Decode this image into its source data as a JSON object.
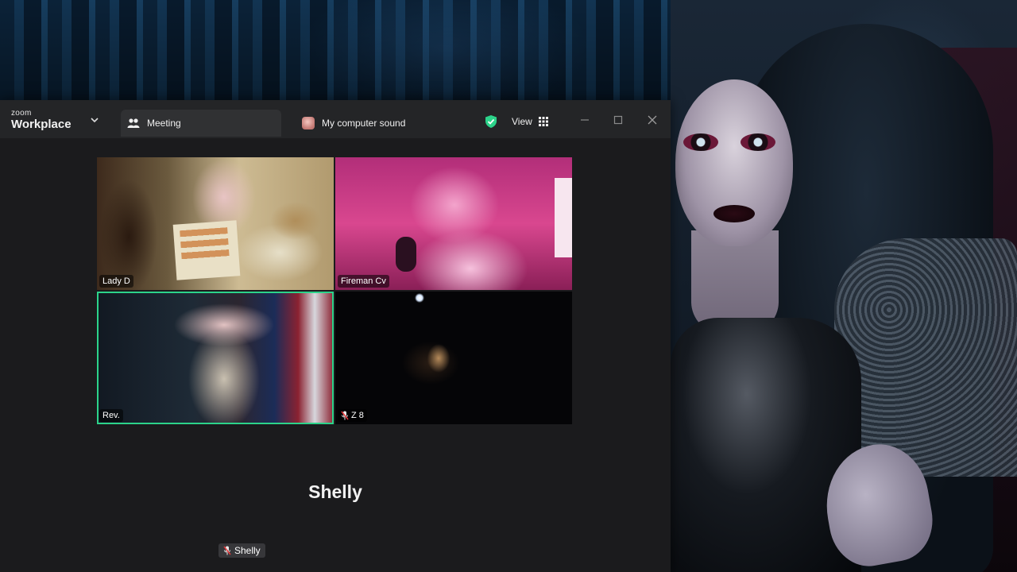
{
  "app": {
    "brand_small": "zoom",
    "brand_big": "Workplace"
  },
  "tabs": [
    {
      "label": "Meeting",
      "active": true
    },
    {
      "label": "My computer sound",
      "active": false
    }
  ],
  "toolbar": {
    "view_label": "View",
    "accent": "#2cd38a"
  },
  "participants": [
    {
      "name": "Lady D",
      "muted": false
    },
    {
      "name": "Fireman Cv",
      "muted": false
    },
    {
      "name": "Rev.",
      "muted": false,
      "active_speaker": true
    },
    {
      "name": "Z 8",
      "muted": true
    }
  ],
  "audio_only": {
    "name_large": "Shelly",
    "name_tag": "Shelly",
    "muted": true
  },
  "icons": [
    "chevron-down-icon",
    "participants-icon",
    "shield-check-icon",
    "grid-icon",
    "minimize-icon",
    "maximize-icon",
    "close-icon",
    "mic-muted-icon"
  ]
}
